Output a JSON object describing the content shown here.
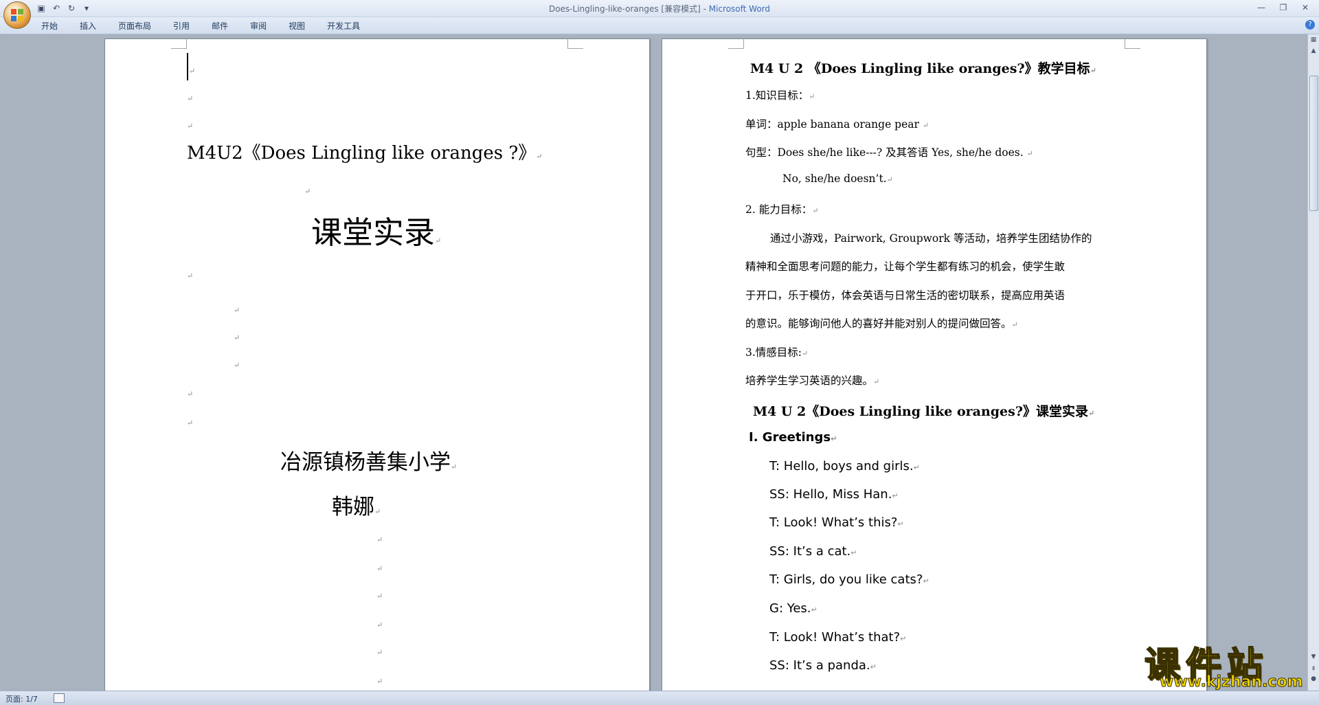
{
  "window": {
    "title": "Does-Lingling-like-oranges [兼容模式] - ",
    "app_name": "Microsoft Word"
  },
  "ribbon": {
    "tabs": [
      "开始",
      "插入",
      "页面布局",
      "引用",
      "邮件",
      "审阅",
      "视图",
      "开发工具"
    ]
  },
  "page1": {
    "mark": "↵",
    "heading": "M4U2《Does Lingling like oranges ?》",
    "title": "课堂实录",
    "school": "冶源镇杨善集小学",
    "author": "韩娜"
  },
  "page2": {
    "title1": "M4 U 2 《Does Lingling like oranges?》教学目标",
    "k_label": "1.知识目标：",
    "words": "单词：apple   banana   orange   pear",
    "pattern": "句型：Does she/he like---?  及其答语 Yes, she/he does.",
    "pattern2": "No, she/he doesn’t.",
    "a_label": "2. 能力目标：",
    "a_line1": "通过小游戏，Pairwork, Groupwork 等活动，培养学生团结协作的",
    "a_line2": "精神和全面思考问题的能力，让每个学生都有练习的机会，使学生敢",
    "a_line3": "于开口，乐于模仿，体会英语与日常生活的密切联系，提高应用英语",
    "a_line4": "的意识。能够询问他人的喜好并能对别人的提问做回答。",
    "e_label": "3.情感目标:",
    "e_text": "培养学生学习英语的兴趣。",
    "title2": "M4 U 2《Does Lingling like oranges?》课堂实录",
    "section": "I. Greetings",
    "dialog": [
      "T: Hello, boys and girls.",
      "SS: Hello, Miss Han.",
      "T: Look! What’s this?",
      "SS: It’s a cat.",
      "T: Girls, do you like cats?",
      "G: Yes.",
      "T: Look! What’s that?",
      "SS: It’s a panda."
    ]
  },
  "status": {
    "page": "页面: 1/7"
  },
  "watermark": {
    "cn": "课件站",
    "url": "www.kjzhan.com"
  }
}
